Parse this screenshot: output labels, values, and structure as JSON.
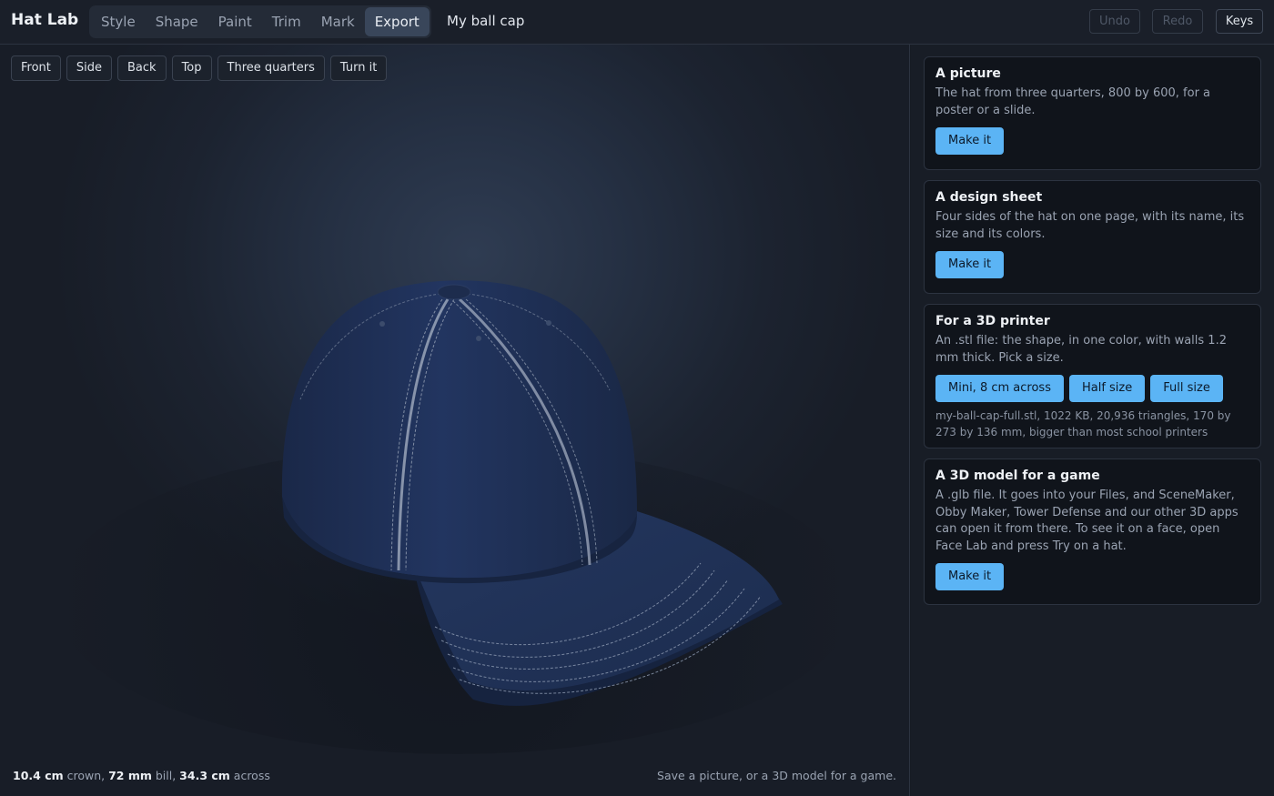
{
  "app": {
    "title": "Hat Lab",
    "doc_name": "My ball cap"
  },
  "tabs": [
    "Style",
    "Shape",
    "Paint",
    "Trim",
    "Mark",
    "Export"
  ],
  "active_tab": "Export",
  "toolbar": {
    "undo": "Undo",
    "redo": "Redo",
    "keys": "Keys"
  },
  "views": [
    "Front",
    "Side",
    "Back",
    "Top",
    "Three quarters",
    "Turn it"
  ],
  "measurements": {
    "crown_value": "10.4 cm",
    "crown_label": " crown, ",
    "bill_value": "72 mm",
    "bill_label": " bill, ",
    "across_value": "34.3 cm",
    "across_label": " across"
  },
  "hint": "Save a picture, or a 3D model for a game.",
  "cards": {
    "picture": {
      "title": "A picture",
      "text": "The hat from three quarters, 800 by 600, for a poster or a slide.",
      "button": "Make it"
    },
    "sheet": {
      "title": "A design sheet",
      "text": "Four sides of the hat on one page, with its name, its size and its colors.",
      "button": "Make it"
    },
    "printer": {
      "title": "For a 3D printer",
      "text": "An .stl file: the shape, in one color, with walls 1.2 mm thick. Pick a size.",
      "buttons": [
        "Mini, 8 cm across",
        "Half size",
        "Full size"
      ],
      "file_info": "my-ball-cap-full.stl, 1022 KB, 20,936 triangles, 170 by 273 by 136 mm, bigger than most school printers"
    },
    "game": {
      "title": "A 3D model for a game",
      "text": "A .glb file. It goes into your Files, and SceneMaker, Obby Maker, Tower Defense and our other 3D apps can open it from there. To see it on a face, open Face Lab and press Try on a hat.",
      "button": "Make it"
    }
  },
  "colors": {
    "accent": "#5bb4f5",
    "hat": "#1e2f52",
    "stitch": "#9aa5b8"
  },
  "icons": [
    "ball-cap-model"
  ]
}
